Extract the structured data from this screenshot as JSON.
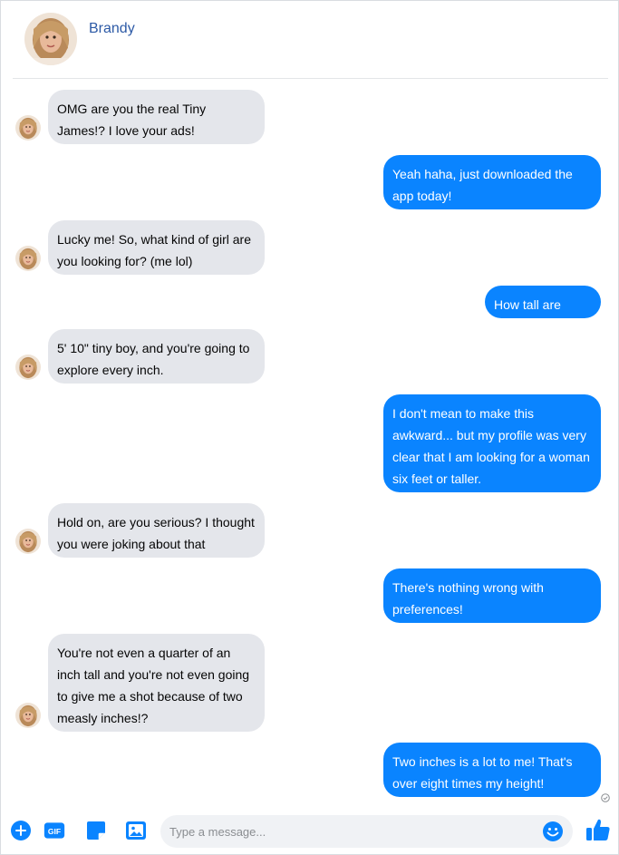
{
  "contact": {
    "name": "Brandy"
  },
  "messages": [
    {
      "side": "in",
      "text": "OMG are you the real Tiny James!? I love your ads!"
    },
    {
      "side": "out",
      "text": "Yeah haha, just downloaded the app today!"
    },
    {
      "side": "in",
      "text": "Lucky me! So, what kind of girl are you looking for? (me lol)"
    },
    {
      "side": "out",
      "text": "How tall are you?"
    },
    {
      "side": "in",
      "text": "5' 10\" tiny boy, and you're going to explore every inch."
    },
    {
      "side": "out",
      "text": "I don't mean to make this awkward... but my profile was very clear that I am looking for a woman six feet or taller."
    },
    {
      "side": "in",
      "text": "Hold on, are you serious? I thought you were joking about that"
    },
    {
      "side": "out",
      "text": "There's nothing wrong with preferences!"
    },
    {
      "side": "in",
      "text": "You're not even a quarter of an inch tall and you're not even going to give me a shot because of two measly inches!?"
    },
    {
      "side": "out",
      "text": "Two inches is a lot to me! That's over eight times my height!"
    }
  ],
  "composer": {
    "placeholder": "Type a message...",
    "gif_label": "GIF",
    "icons": [
      "plus-circle-icon",
      "gif-icon",
      "sticker-icon",
      "image-icon",
      "emoji-icon",
      "thumbs-up-icon"
    ]
  },
  "colors": {
    "accent": "#0a84ff",
    "incoming_bubble": "#e4e6eb",
    "name": "#2d5aa6"
  }
}
